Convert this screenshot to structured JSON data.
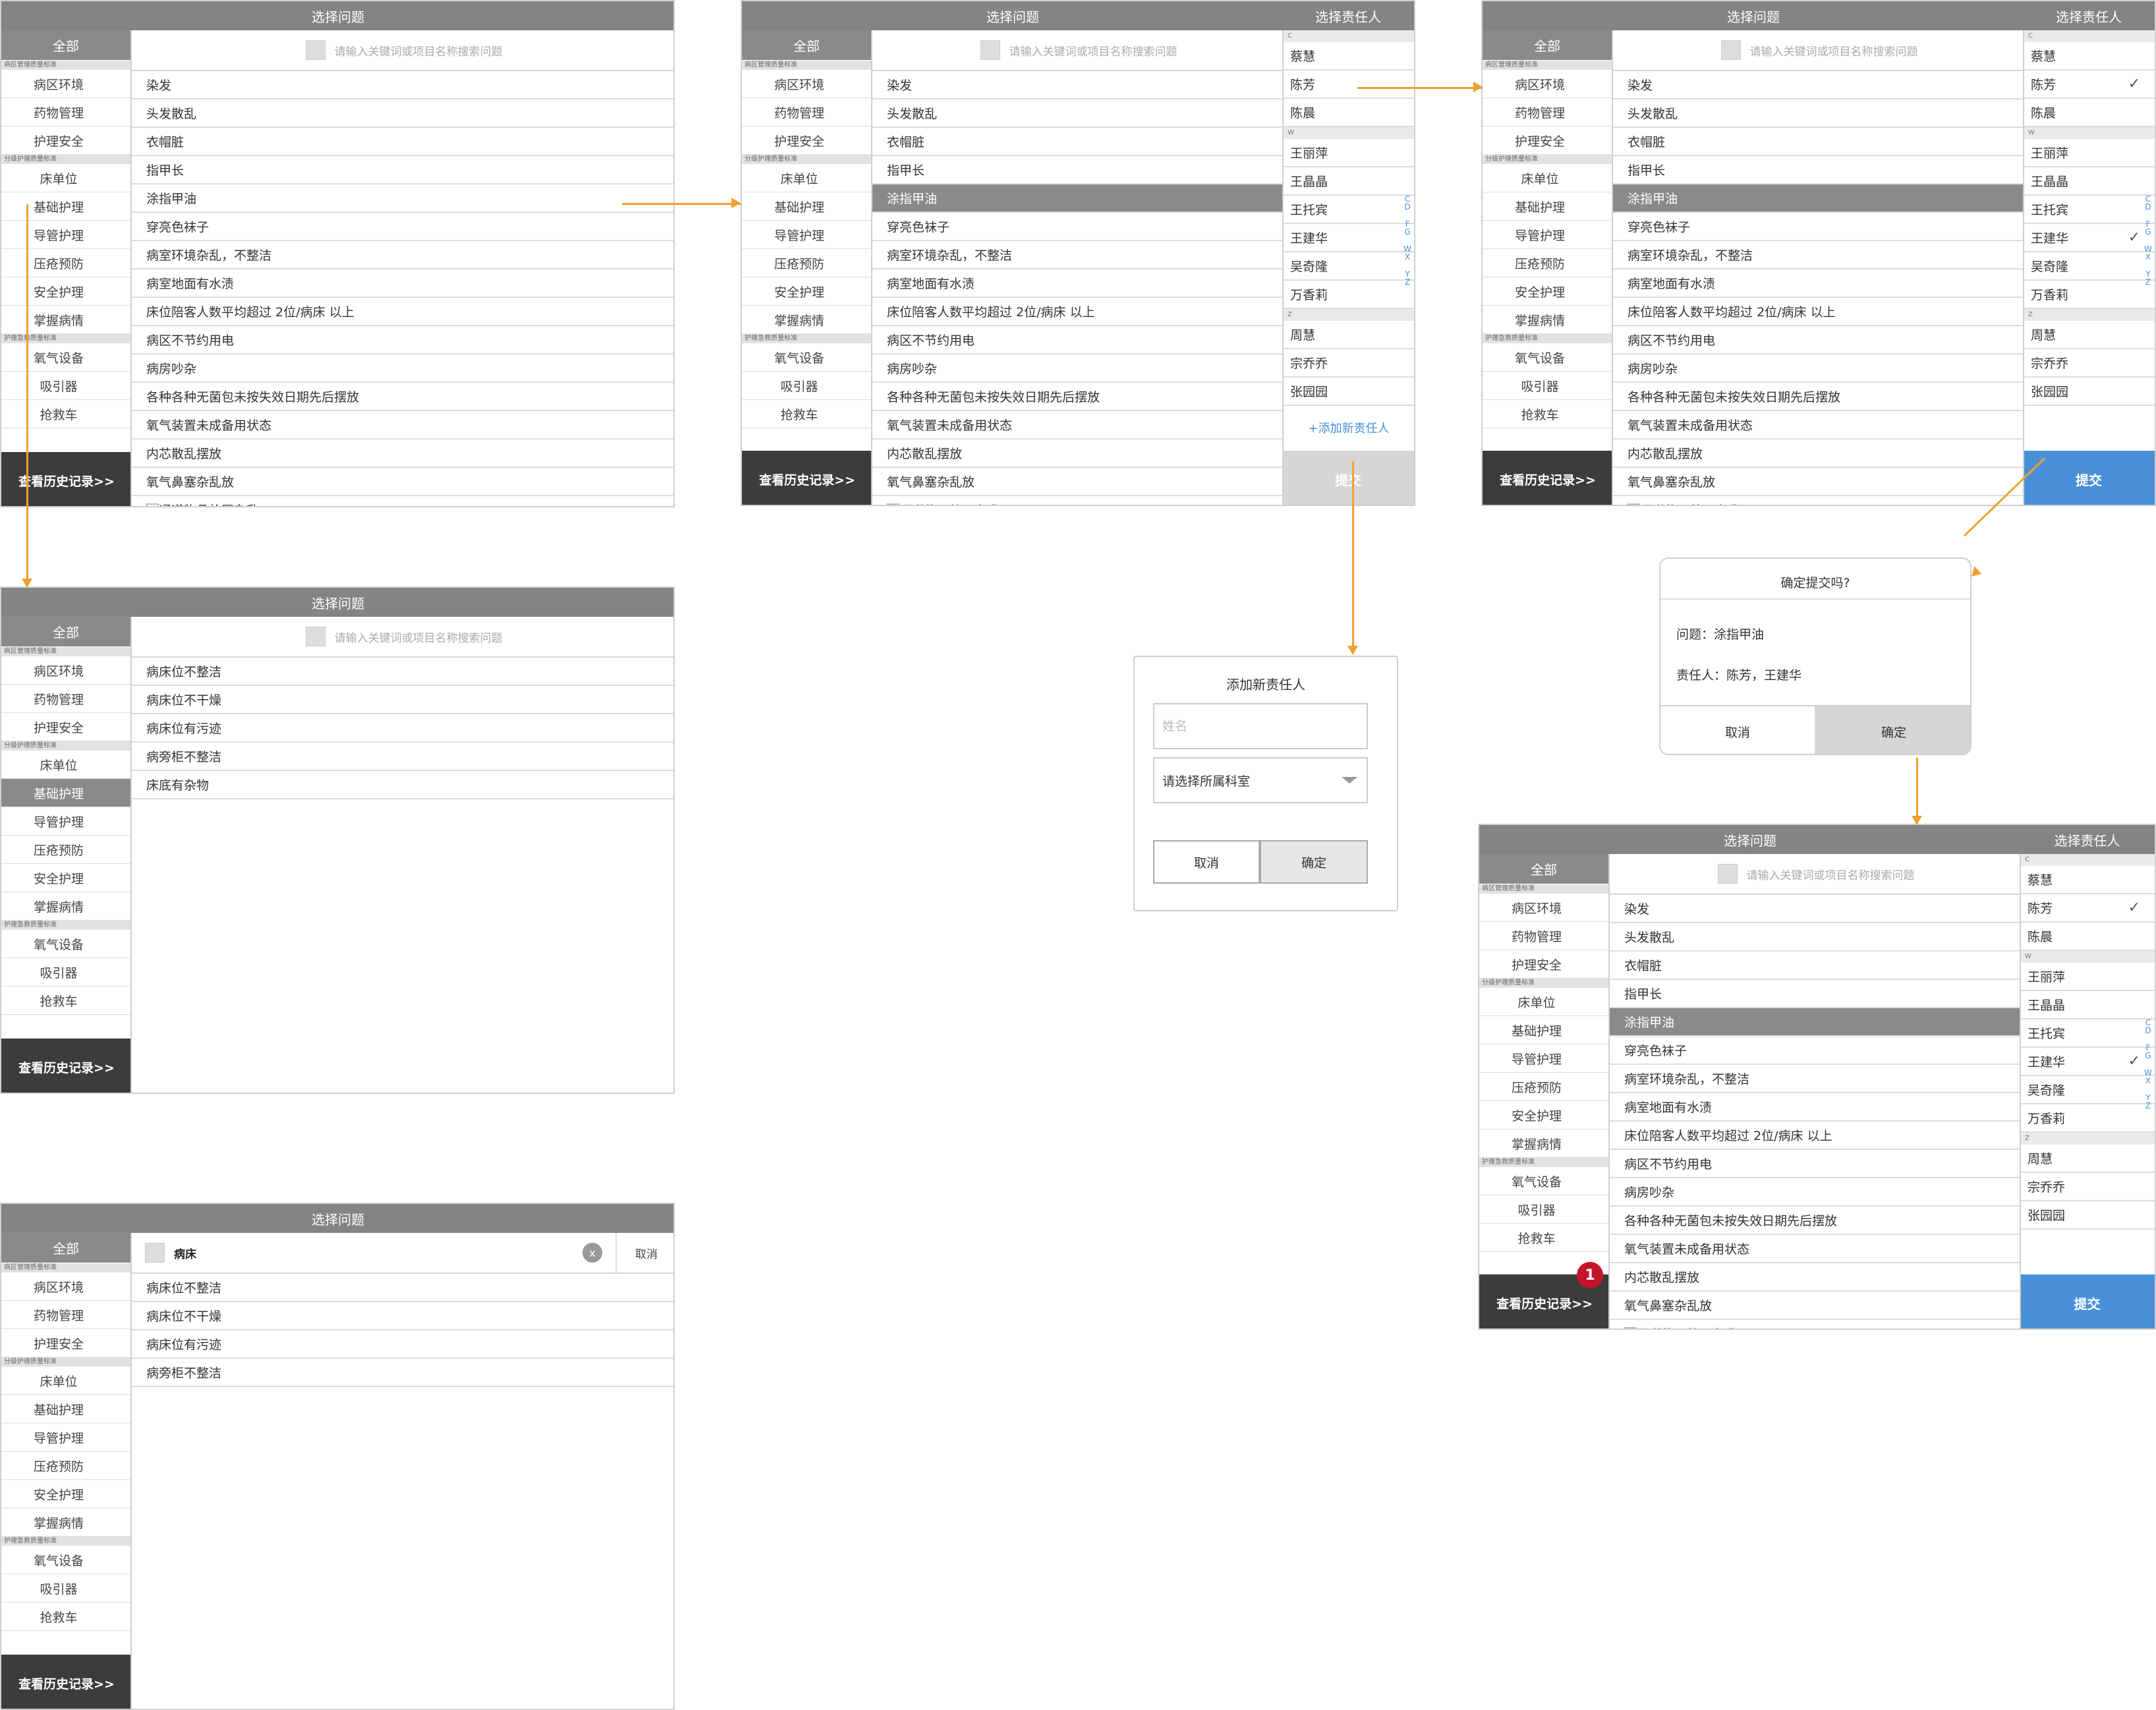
{
  "common": {
    "title": "选择问题",
    "person_title": "选择责任人",
    "all": "全部",
    "sec1": "病区管理质量标准",
    "sec2": "分级护理质量标准",
    "sec3": "护理急救质量标准",
    "history": "查看历史记录>>",
    "search_placeholder": "请输入关键词或项目名称搜索问题",
    "side_g1": [
      "病区环境",
      "药物管理",
      "护理安全"
    ],
    "side_g2": [
      "床单位",
      "基础护理",
      "导管护理",
      "压疮预防",
      "安全护理",
      "掌握病情"
    ],
    "side_g3": [
      "氧气设备",
      "吸引器",
      "抢救车"
    ],
    "submit": "提交",
    "add_person": "+添加新责任人"
  },
  "issues": [
    "染发",
    "头发散乱",
    "衣帽脏",
    "指甲长",
    "涂指甲油",
    "穿亮色袜子",
    "病室环境杂乱，不整洁",
    "病室地面有水渍",
    "床位陪客人数平均超过 2位/病床 以上",
    "病区不节约用电",
    "病房吵杂",
    "各种各种无菌包未按失效日期先后摆放",
    "氧气装置未成备用状态",
    "内芯散乱摆放",
    "氧气鼻塞杂乱放",
    "\u001f通道物品放置杂乱"
  ],
  "issues_first_screen": [
    "染发",
    "头发散乱",
    "衣帽脏",
    "指甲长",
    "涂指甲油",
    "穿亮色袜子",
    "病室环境杂乱，不整洁",
    "病室地面有水渍",
    "床位陪客人数平均超过 2位/病床 以上",
    "病区不节约用电",
    "病房吵杂",
    "各种各种无菌包未按失效日期先后摆放",
    "氧气装置未成备用状态",
    "内芯散乱摆放",
    "氧气鼻塞杂乱放"
  ],
  "issues_basic": [
    "病床位不整洁",
    "病床位不干燥",
    "病床位有污迹",
    "病旁柜不整洁",
    "床底有杂物"
  ],
  "search_screen": {
    "query": "病床",
    "clear": "x",
    "cancel": "取消",
    "results": [
      "病床位不整洁",
      "病床位不干燥",
      "病床位有污迹",
      "病旁柜不整洁"
    ]
  },
  "persons": [
    {
      "letter": "C",
      "names": [
        "蔡慧",
        "陈芳",
        "陈晨"
      ]
    },
    {
      "letter": "W",
      "names": [
        "王丽萍",
        "王晶晶",
        "王托宾",
        "王建华",
        "吴奇隆",
        "万香莉"
      ]
    },
    {
      "letter": "Z",
      "names": [
        "周慧",
        "宗乔乔",
        "张园园"
      ]
    }
  ],
  "index_letters": [
    "C",
    "D",
    "F",
    "G",
    "W",
    "X",
    "Y",
    "Z"
  ],
  "add_dialog": {
    "title": "添加新责任人",
    "name_placeholder": "姓名",
    "dept": "请选择所属科室",
    "cancel": "取消",
    "ok": "确定"
  },
  "confirm_dialog": {
    "title": "确定提交吗?",
    "issue": "问题：涂指甲油",
    "persons": "责任人：陈芳，王建华",
    "cancel": "取消",
    "ok": "确定"
  },
  "badge": "1",
  "colors": {
    "accent": "#4a90d9",
    "arrow": "#f0a030",
    "header": "#848484",
    "dark": "#3c3c3c",
    "badge": "#c4142b"
  }
}
